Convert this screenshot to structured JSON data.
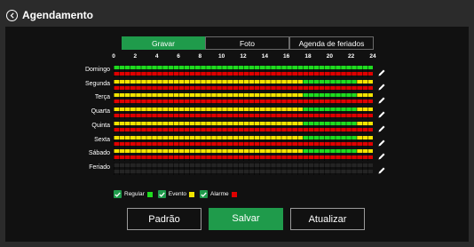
{
  "header": {
    "title": "Agendamento"
  },
  "tabs": [
    {
      "label": "Gravar",
      "active": true
    },
    {
      "label": "Foto",
      "active": false
    },
    {
      "label": "Agenda de feriados",
      "active": false
    }
  ],
  "hour_labels": [
    "0",
    "2",
    "4",
    "6",
    "8",
    "10",
    "12",
    "14",
    "16",
    "18",
    "20",
    "22",
    "24"
  ],
  "days": [
    {
      "label": "Domingo",
      "regular": [
        [
          0,
          24
        ]
      ],
      "event": [],
      "alarm": [
        [
          0,
          24
        ]
      ]
    },
    {
      "label": "Segunda",
      "regular": [
        [
          17.5,
          22.5
        ]
      ],
      "event": [
        [
          0,
          17.5
        ],
        [
          22.5,
          24
        ]
      ],
      "alarm": [
        [
          0,
          24
        ]
      ]
    },
    {
      "label": "Terça",
      "regular": [
        [
          17.5,
          22.5
        ]
      ],
      "event": [
        [
          0,
          17.5
        ],
        [
          22.5,
          24
        ]
      ],
      "alarm": [
        [
          0,
          24
        ]
      ]
    },
    {
      "label": "Quarta",
      "regular": [
        [
          17.5,
          22.5
        ]
      ],
      "event": [
        [
          0,
          17.5
        ],
        [
          22.5,
          24
        ]
      ],
      "alarm": [
        [
          0,
          24
        ]
      ]
    },
    {
      "label": "Quinta",
      "regular": [
        [
          17.5,
          22.5
        ]
      ],
      "event": [
        [
          0,
          17.5
        ],
        [
          22.5,
          24
        ]
      ],
      "alarm": [
        [
          0,
          24
        ]
      ]
    },
    {
      "label": "Sexta",
      "regular": [
        [
          17.5,
          22.5
        ]
      ],
      "event": [
        [
          0,
          17.5
        ],
        [
          22.5,
          24
        ]
      ],
      "alarm": [
        [
          0,
          24
        ]
      ]
    },
    {
      "label": "Sábado",
      "regular": [
        [
          17.5,
          22.5
        ]
      ],
      "event": [
        [
          0,
          17.5
        ],
        [
          22.5,
          24
        ]
      ],
      "alarm": [
        [
          0,
          24
        ]
      ]
    },
    {
      "label": "Feriado",
      "regular": [],
      "event": [],
      "alarm": []
    }
  ],
  "legend": [
    {
      "label": "Regular",
      "color": "#1fdc1f",
      "checked": true
    },
    {
      "label": "Evento",
      "color": "#f2e400",
      "checked": true
    },
    {
      "label": "Alarme",
      "color": "#e00000",
      "checked": true
    }
  ],
  "colors": {
    "regular": "#1fdc1f",
    "event": "#f2e400",
    "alarm": "#e00000",
    "accent": "#1f9b4b"
  },
  "buttons": {
    "default_label": "Padrão",
    "save_label": "Salvar",
    "refresh_label": "Atualizar"
  },
  "icons": {
    "back": "chevron-left-circle-icon",
    "edit": "pencil-icon",
    "check": "checkmark-icon"
  }
}
